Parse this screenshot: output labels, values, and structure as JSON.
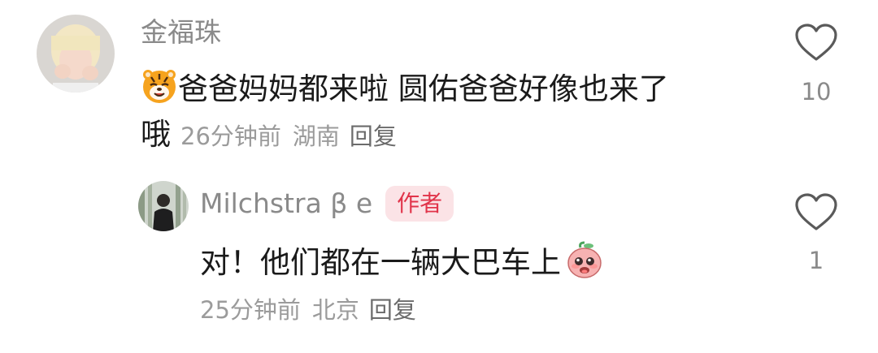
{
  "comments": [
    {
      "username": "金福珠",
      "text_line1": "爸爸妈妈都来啦 圆佑爸爸好像也来了",
      "text_line2": "哦",
      "time": "26分钟前",
      "location": "湖南",
      "reply_label": "回复",
      "likes": "10",
      "emoji_icon": "tiger-face-emoji",
      "avatar_icon": "user-avatar-blonde"
    },
    {
      "username": "Milchstra β e",
      "author_badge": "作者",
      "text": "对！他们都在一辆大巴车上",
      "time": "25分钟前",
      "location": "北京",
      "reply_label": "回复",
      "likes": "1",
      "emoji_icon": "pink-peach-starry-eyes-emoji",
      "avatar_icon": "user-avatar-forest"
    }
  ]
}
